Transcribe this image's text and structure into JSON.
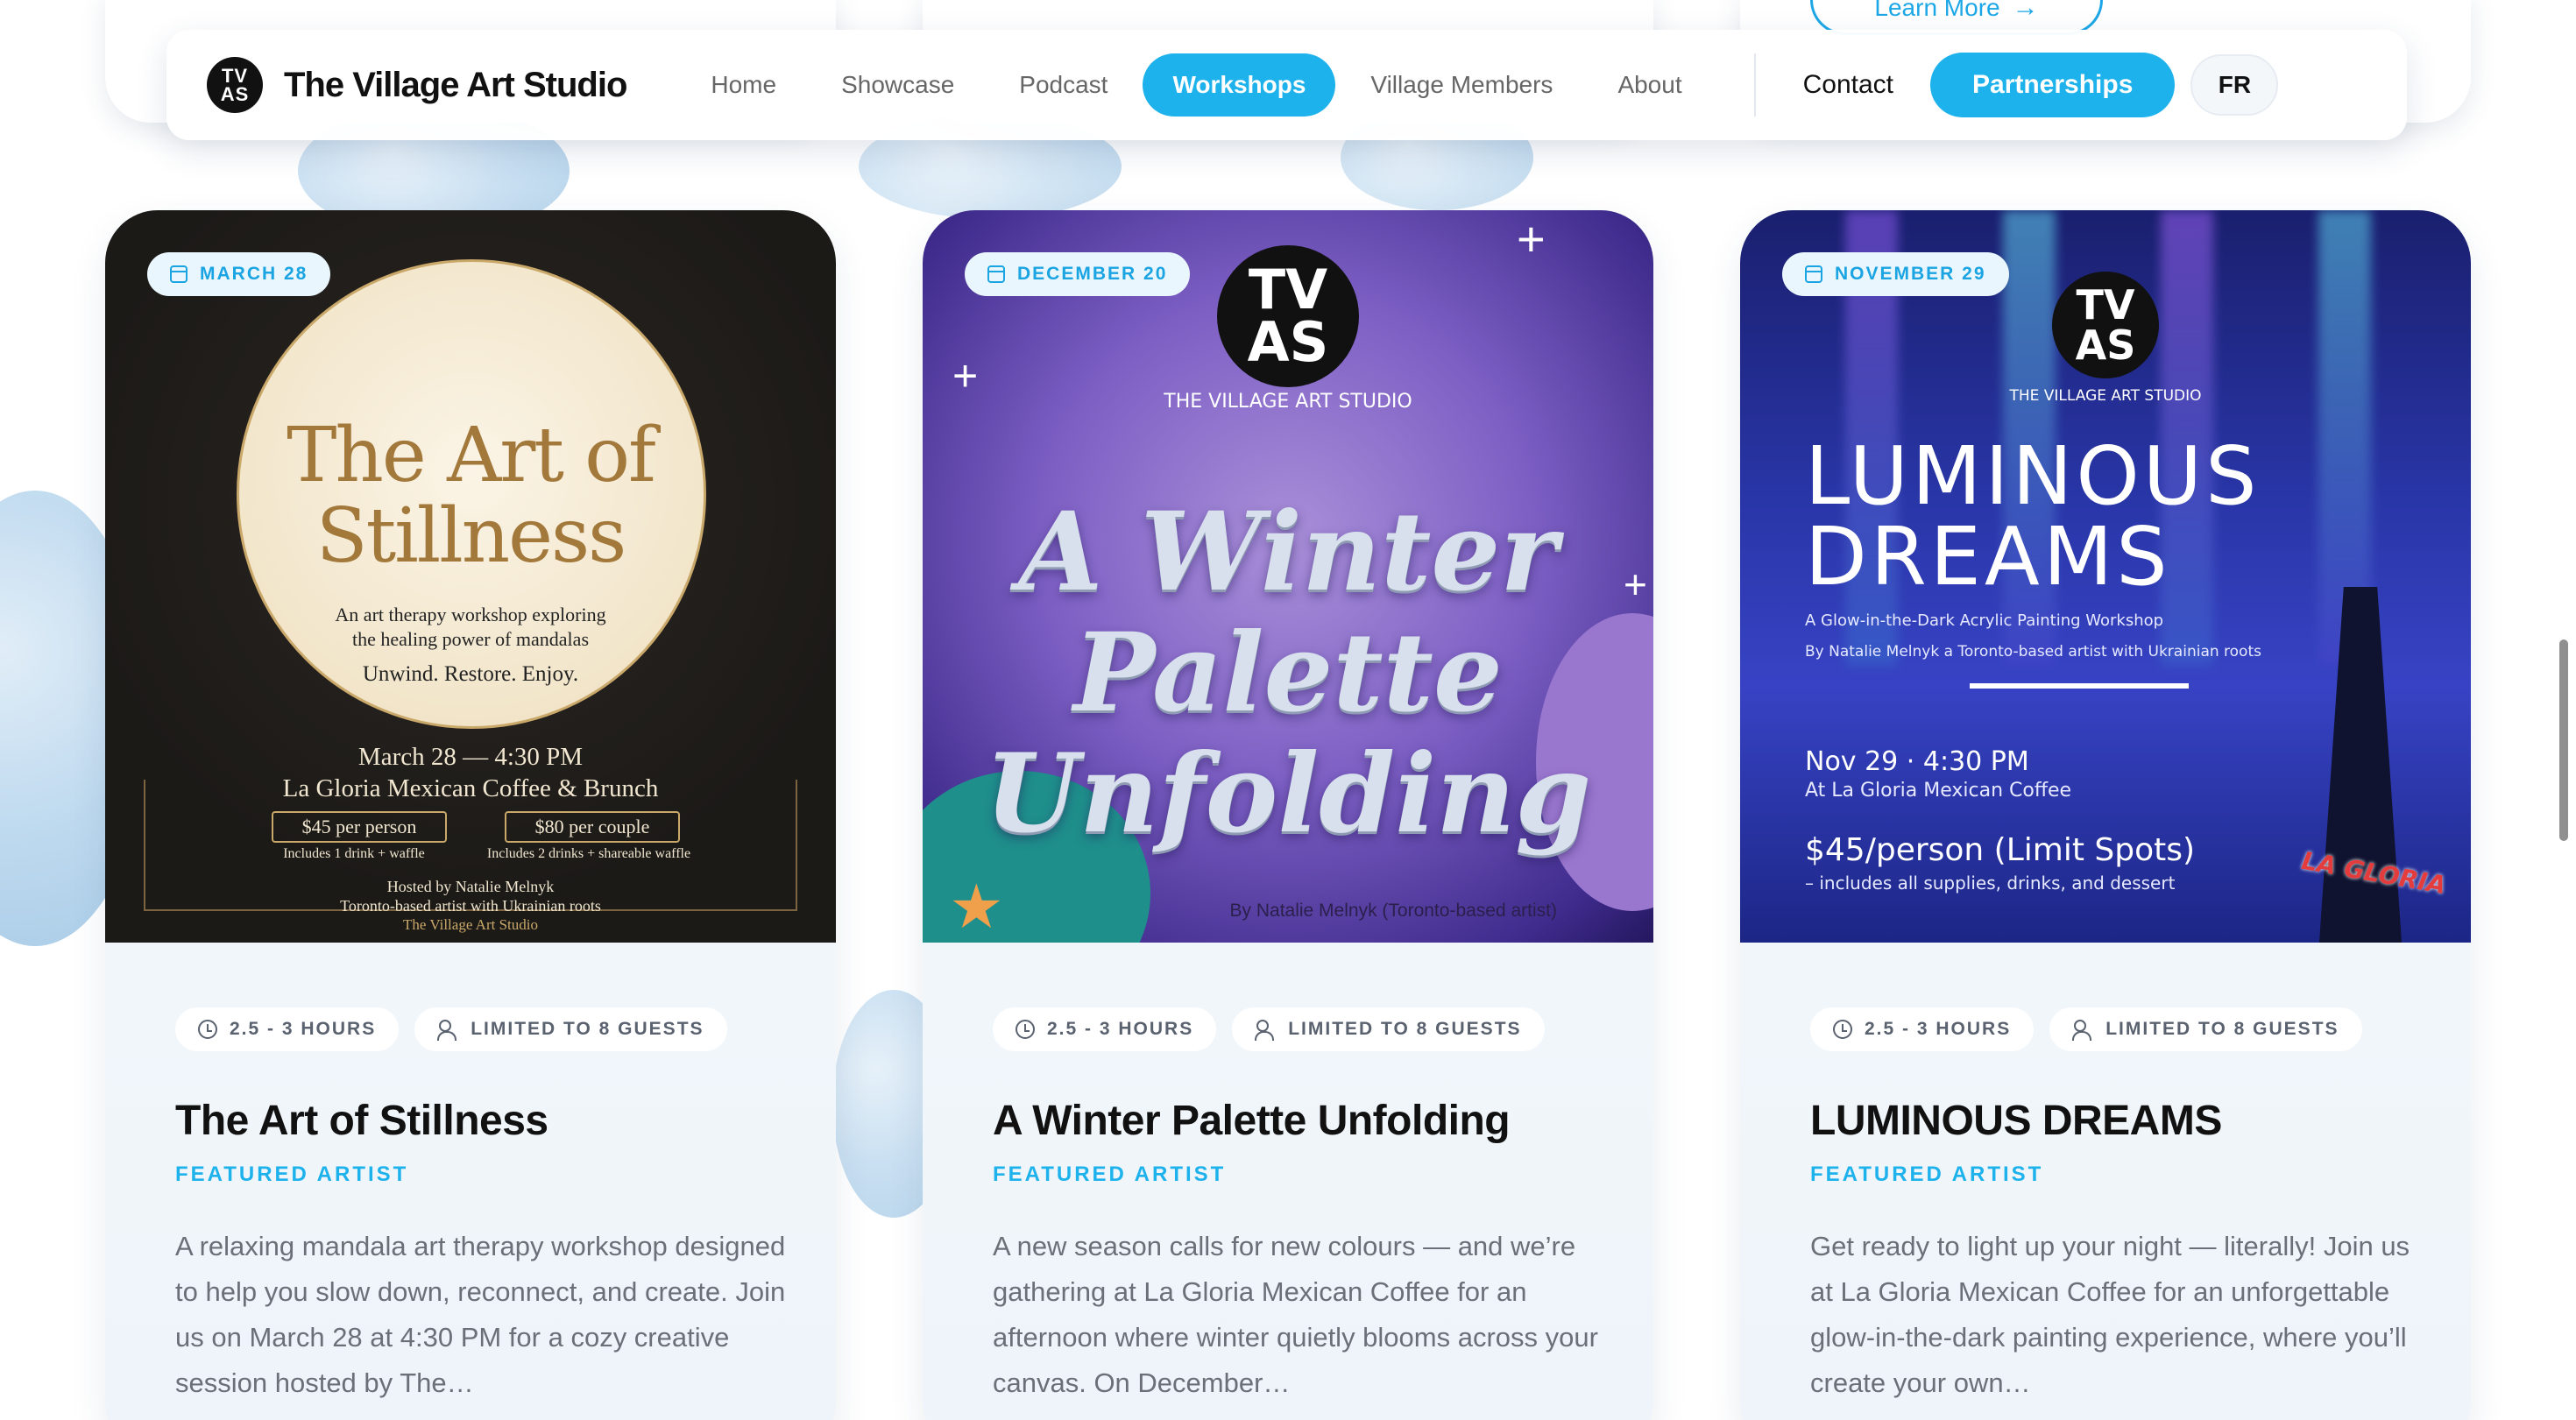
{
  "top": {
    "learn_more_label": "Learn More",
    "learn_more_icon": "arrow-right-icon"
  },
  "nav": {
    "logo_text_top": "TV",
    "logo_text_bottom": "AS",
    "brand": "The Village Art Studio",
    "links": [
      {
        "label": "Home",
        "active": false
      },
      {
        "label": "Showcase",
        "active": false
      },
      {
        "label": "Podcast",
        "active": false
      },
      {
        "label": "Workshops",
        "active": true
      },
      {
        "label": "Village Members",
        "active": false
      },
      {
        "label": "About",
        "active": false
      }
    ],
    "contact": "Contact",
    "partnerships": "Partnerships",
    "language": "FR",
    "accent_color": "#1eb2ec"
  },
  "cards": [
    {
      "date": "MARCH 28",
      "duration": "2.5 - 3 HOURS",
      "guests": "LIMITED TO 8 GUESTS",
      "title": "The Art of Stillness",
      "tag": "FEATURED ARTIST",
      "description": "A relaxing mandala art therapy workshop designed to help you slow down, reconnect, and create. Join us on March 28 at 4:30 PM for a cozy creative session hosted by The…",
      "poster": {
        "title_line1": "The Art of",
        "title_line2": "Stillness",
        "subtitle_line1": "An art therapy workshop exploring",
        "subtitle_line2": "the healing power of mandalas",
        "tagline": "Unwind. Restore. Enjoy.",
        "when": "March 28 — 4:30 PM",
        "where": "La Gloria Mexican Coffee & Brunch",
        "price1": "$45 per person",
        "price1_note": "Includes 1 drink + waffle",
        "price2": "$80 per couple",
        "price2_note": "Includes 2 drinks + shareable waffle",
        "host_line1": "Hosted by Natalie Melnyk",
        "host_line2": "Toronto-based artist with Ukrainian roots",
        "host_line3": "The Village Art Studio"
      }
    },
    {
      "date": "DECEMBER 20",
      "duration": "2.5 - 3 HOURS",
      "guests": "LIMITED TO 8 GUESTS",
      "title": "A Winter Palette Unfolding",
      "tag": "FEATURED ARTIST",
      "description": "A new season calls for new colours — and we’re gathering at La Gloria Mexican Coffee for an afternoon where winter quietly blooms across your canvas. On December…",
      "poster": {
        "logo_top": "TV",
        "logo_bottom": "AS",
        "studio": "THE VILLAGE ART STUDIO",
        "title_line1": "A Winter",
        "title_line2": "Palette",
        "title_line3": "Unfolding",
        "credit": "By Natalie  Melnyk (Toronto-based artist)"
      }
    },
    {
      "date": "NOVEMBER 29",
      "duration": "2.5 - 3 HOURS",
      "guests": "LIMITED TO 8 GUESTS",
      "title": "LUMINOUS DREAMS",
      "tag": "FEATURED ARTIST",
      "description": "Get ready to light up your night — literally! Join us at La Gloria Mexican Coffee for an unforgettable glow-in-the-dark painting experience, where you’ll create your own…",
      "poster": {
        "logo_top": "TV",
        "logo_bottom": "AS",
        "studio": "THE VILLAGE ART STUDIO",
        "title_line1": "LUMINOUS",
        "title_line2": "DREAMS",
        "sub1": "A Glow-in-the-Dark Acrylic Painting Workshop",
        "sub2": "By Natalie Melnyk a Toronto-based artist with Ukrainian roots",
        "when": "Nov 29 · 4:30 PM",
        "where": "At La Gloria Mexican Coffee",
        "price": "$45/person (Limit Spots)",
        "price_note": "– includes all supplies, drinks, and dessert",
        "venue_logo": "LA GLORIA"
      }
    }
  ]
}
